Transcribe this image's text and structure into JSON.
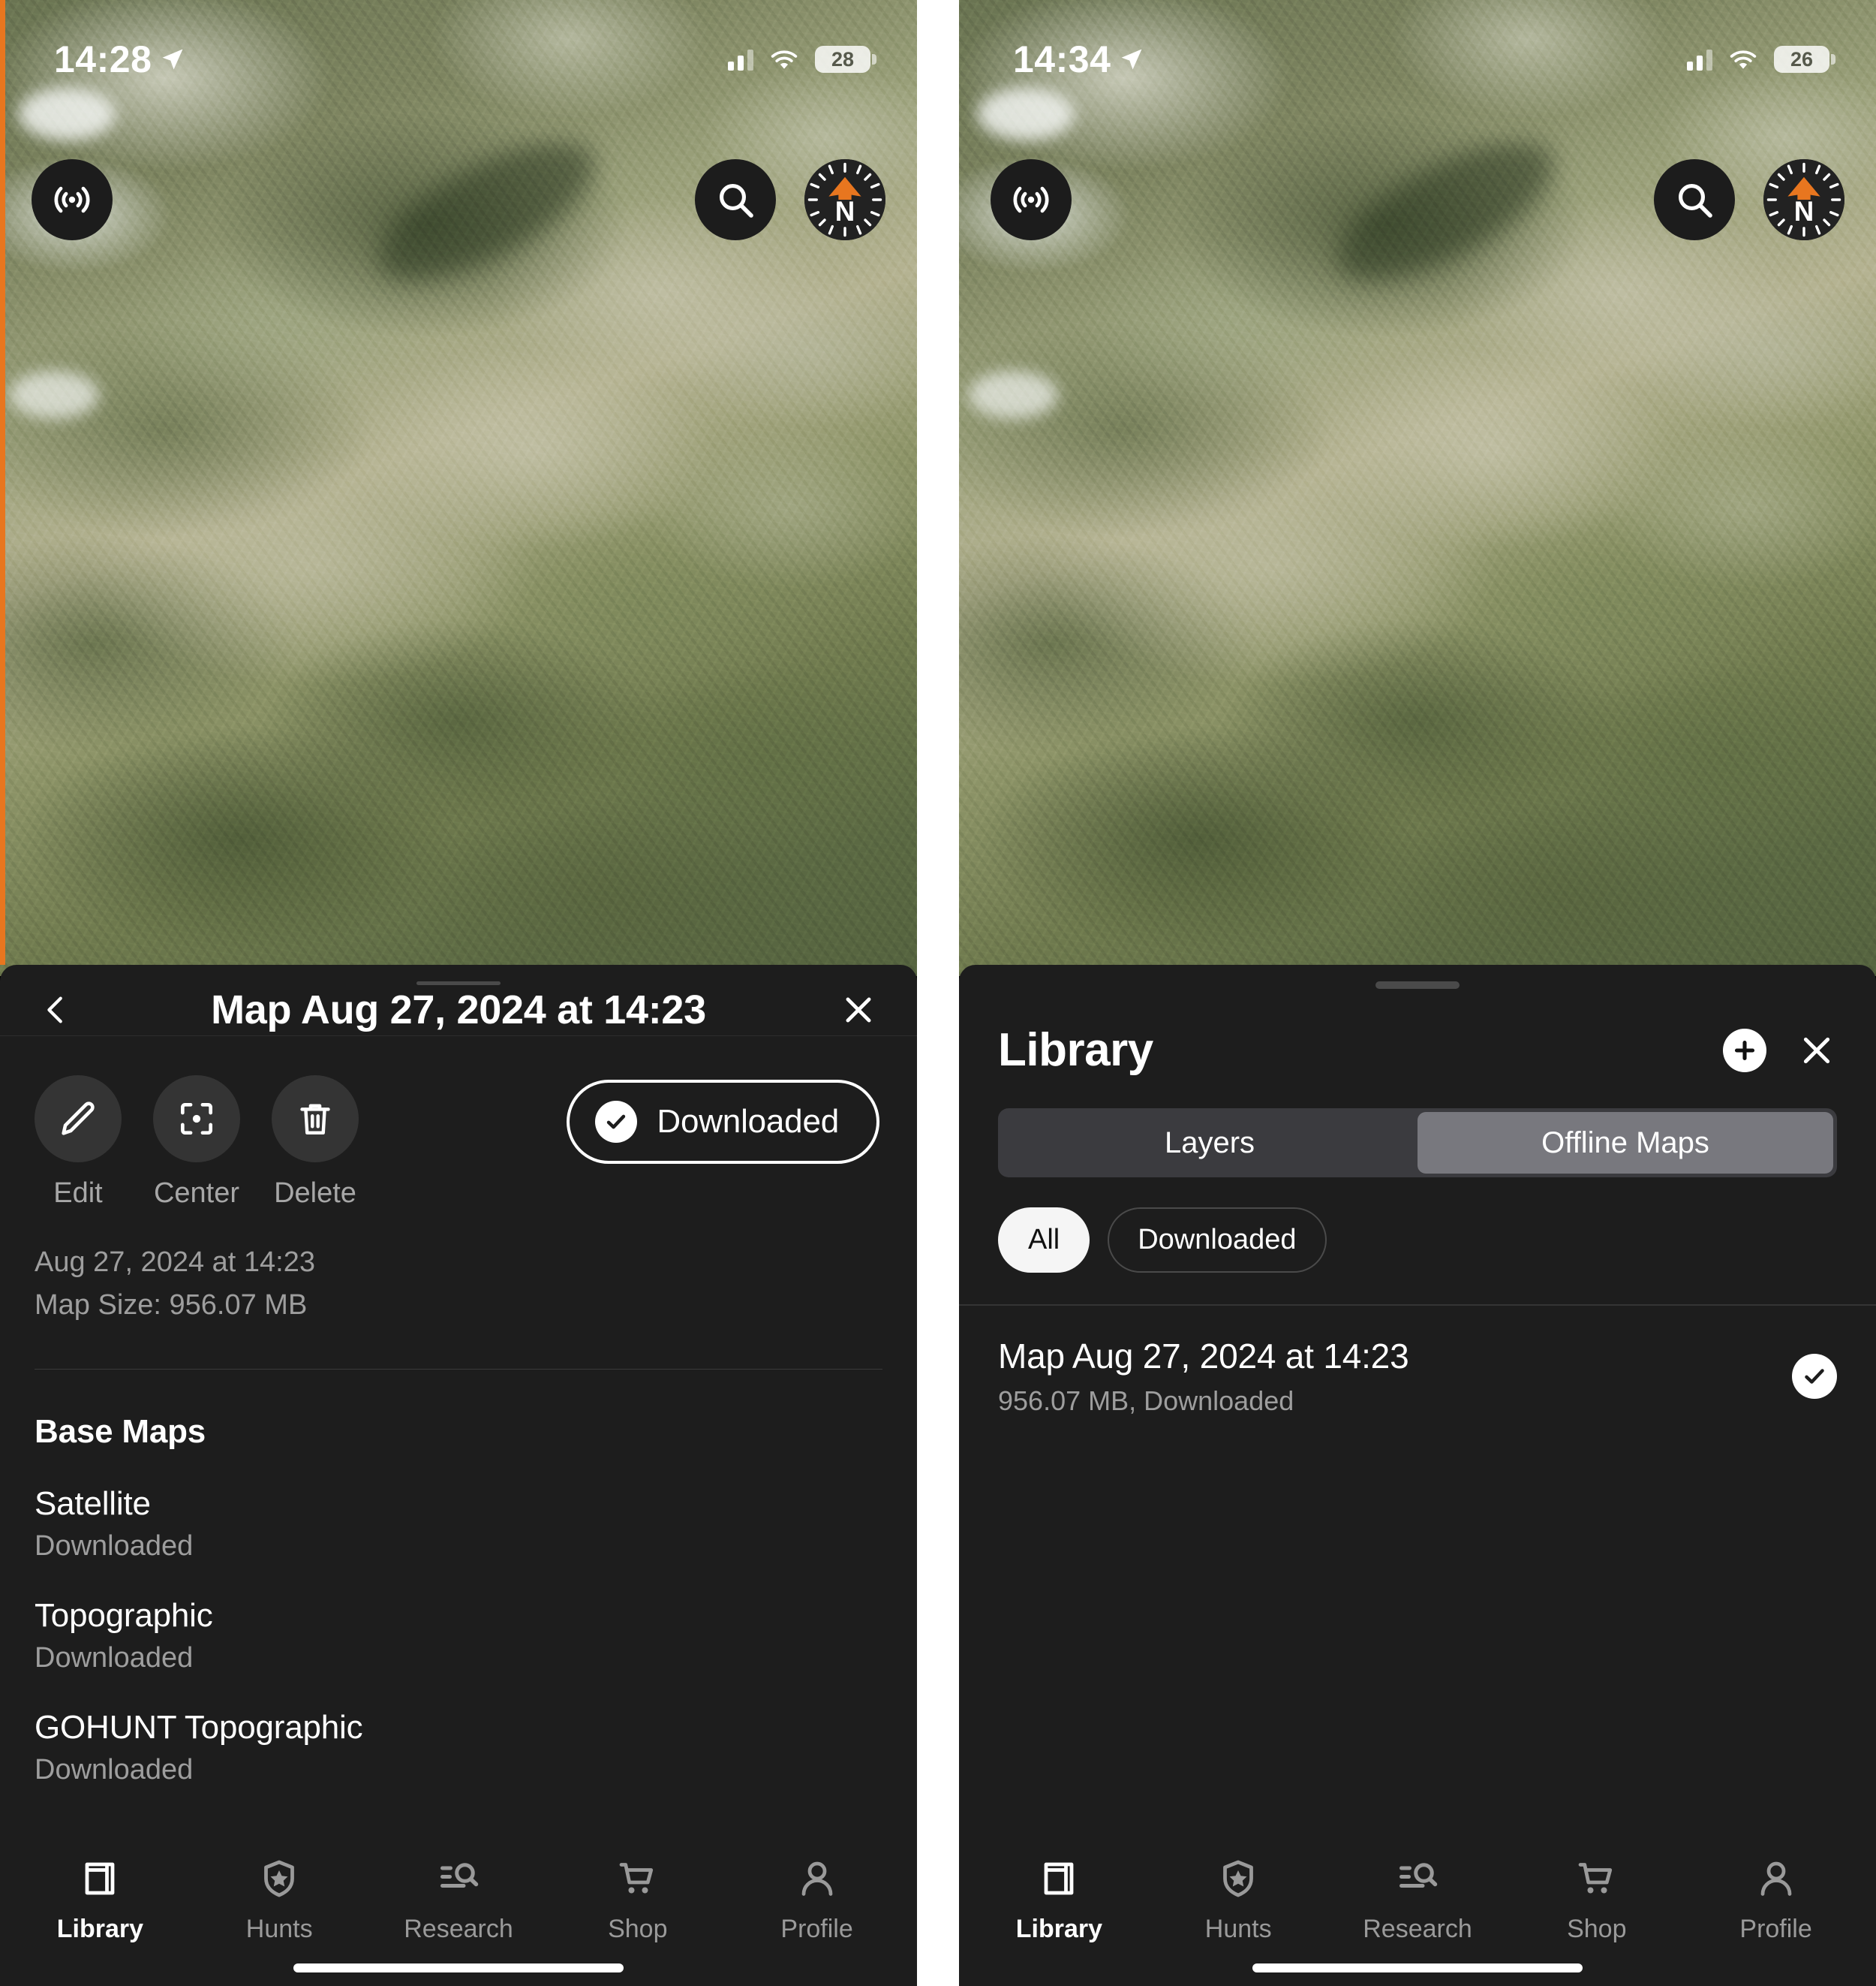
{
  "left_phone": {
    "status_bar": {
      "time": "14:28",
      "battery": "28",
      "location_icon": "location-arrow-icon",
      "wifi_icon": "wifi-icon",
      "cellular_icon": "cellular-bars-icon"
    },
    "map_controls": {
      "broadcast_label": "broadcast-icon",
      "search_label": "search-icon",
      "compass_label": "compass-icon",
      "compass_north": "N"
    },
    "sheet": {
      "back_label": "chevron-left-icon",
      "title": "Map Aug 27, 2024 at 14:23",
      "close_label": "close-icon",
      "actions": [
        {
          "icon": "pencil-icon",
          "label": "Edit"
        },
        {
          "icon": "center-crosshair-icon",
          "label": "Center"
        },
        {
          "icon": "trash-icon",
          "label": "Delete"
        }
      ],
      "download_pill": {
        "label": "Downloaded",
        "icon": "check-circle-icon"
      },
      "meta": {
        "date": "Aug 27, 2024 at 14:23",
        "size": "Map Size: 956.07 MB"
      },
      "base_maps_heading": "Base Maps",
      "base_maps": [
        {
          "name": "Satellite",
          "status": "Downloaded"
        },
        {
          "name": "Topographic",
          "status": "Downloaded"
        },
        {
          "name": "GOHUNT Topographic",
          "status": "Downloaded"
        }
      ]
    },
    "tabs": [
      {
        "label": "Library",
        "icon": "book-icon",
        "active": true
      },
      {
        "label": "Hunts",
        "icon": "shield-star-icon",
        "active": false
      },
      {
        "label": "Research",
        "icon": "list-search-icon",
        "active": false
      },
      {
        "label": "Shop",
        "icon": "cart-icon",
        "active": false
      },
      {
        "label": "Profile",
        "icon": "person-icon",
        "active": false
      }
    ]
  },
  "right_phone": {
    "status_bar": {
      "time": "14:34",
      "battery": "26",
      "location_icon": "location-arrow-icon",
      "wifi_icon": "wifi-icon",
      "cellular_icon": "cellular-bars-icon"
    },
    "map_controls": {
      "broadcast_label": "broadcast-icon",
      "search_label": "search-icon",
      "compass_label": "compass-icon",
      "compass_north": "N"
    },
    "sheet": {
      "title": "Library",
      "add_label": "plus-icon",
      "close_label": "close-icon",
      "segments": [
        {
          "label": "Layers",
          "active": false
        },
        {
          "label": "Offline Maps",
          "active": true
        }
      ],
      "chips": [
        {
          "label": "All",
          "selected": true
        },
        {
          "label": "Downloaded",
          "selected": false
        }
      ],
      "rows": [
        {
          "title": "Map Aug 27, 2024 at 14:23",
          "subtitle": "956.07 MB, Downloaded",
          "checked": true
        }
      ]
    },
    "tabs": [
      {
        "label": "Library",
        "icon": "book-icon",
        "active": true
      },
      {
        "label": "Hunts",
        "icon": "shield-star-icon",
        "active": false
      },
      {
        "label": "Research",
        "icon": "list-search-icon",
        "active": false
      },
      {
        "label": "Shop",
        "icon": "cart-icon",
        "active": false
      },
      {
        "label": "Profile",
        "icon": "person-icon",
        "active": false
      }
    ]
  },
  "colors": {
    "accent_orange": "#e8761f",
    "sheet_bg": "#1d1d1d",
    "segment_active": "#78787e"
  }
}
